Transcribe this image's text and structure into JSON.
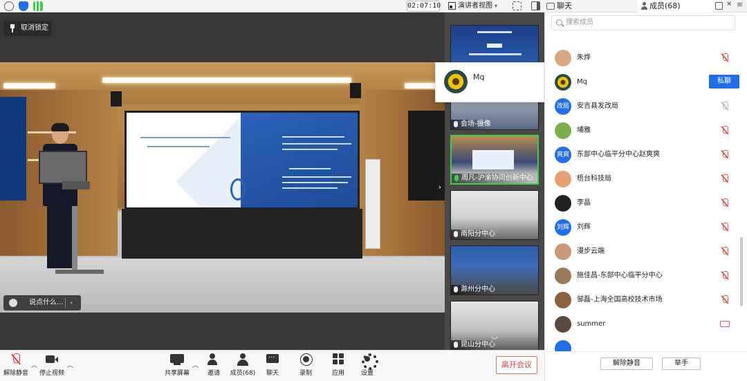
{
  "topbar": {
    "timer": "02:07:10",
    "view_label": "演讲者视图"
  },
  "side_tabs": {
    "chat": "聊天",
    "members": "成员(68)"
  },
  "stage": {
    "unlock_label": "取消锁定",
    "say_placeholder": "说点什么..."
  },
  "popup": {
    "name": "Mq"
  },
  "thumbnails": [
    {
      "caption": ""
    },
    {
      "caption": "会场-摄像"
    },
    {
      "caption": "周凡-沪渝协同创新中心"
    },
    {
      "caption": "南阳分中心"
    },
    {
      "caption": "滁州分中心"
    },
    {
      "caption": "昆山分中心"
    }
  ],
  "members_panel": {
    "search_placeholder": "搜索成员",
    "dm_label": "私聊",
    "members": [
      {
        "name": "朱烨",
        "avatar": "",
        "color": "#d9a882"
      },
      {
        "name": "Mq",
        "avatar": "",
        "color": "#2a4a46"
      },
      {
        "name": "安吉县发改局",
        "avatar": "改局",
        "color": "#1f6fe8"
      },
      {
        "name": "埔雅",
        "avatar": "",
        "color": "#7ab04a"
      },
      {
        "name": "东部中心临平分中心赵爽爽",
        "avatar": "爽爽",
        "color": "#1f6fe8"
      },
      {
        "name": "梧台科技局",
        "avatar": "",
        "color": "#e8a070"
      },
      {
        "name": "李晶",
        "avatar": "",
        "color": "#222222"
      },
      {
        "name": "刘辉",
        "avatar": "刘辉",
        "color": "#1f6fe8"
      },
      {
        "name": "漫步云端",
        "avatar": "",
        "color": "#c99878"
      },
      {
        "name": "施佳昌-东部中心临平分中心",
        "avatar": "",
        "color": "#9a7a5a"
      },
      {
        "name": "邹磊-上海全国高校技术市场",
        "avatar": "",
        "color": "#8a6040"
      },
      {
        "name": "summer",
        "avatar": "",
        "color": "#5a4a40"
      }
    ],
    "unmute_all": "解除静音",
    "raise_hand": "举手"
  },
  "toolbar": {
    "unmute": "解除静音",
    "stop_video": "停止视频",
    "share": "共享屏幕",
    "invite": "邀请",
    "members": "成员(68)",
    "chat": "聊天",
    "record": "录制",
    "apps": "应用",
    "settings": "设置",
    "end": "离开会议"
  },
  "colors": {
    "accent": "#1f6fe8",
    "danger": "#e04040",
    "active_speaker": "#3bd04a"
  }
}
